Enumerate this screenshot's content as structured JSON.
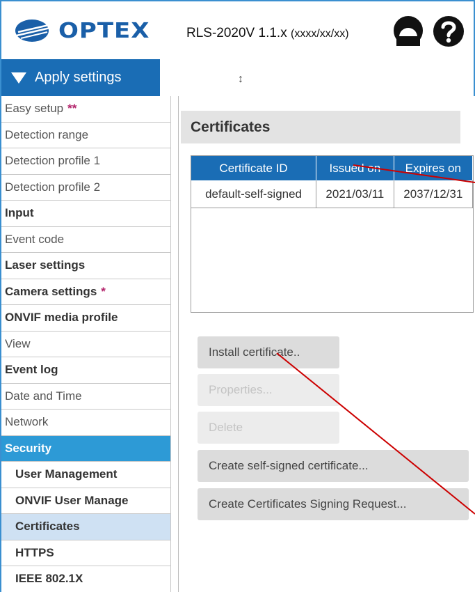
{
  "header": {
    "logo_text": "OPTEX",
    "model": "RLS-2020V 1.1.x",
    "model_date": "(xxxx/xx/xx)",
    "user_icon": "user-circle-icon",
    "help_icon": "question-circle-icon"
  },
  "apply": {
    "label": "Apply settings",
    "resize_glyph": "↕"
  },
  "sidebar": {
    "items": [
      {
        "label": "Easy setup",
        "marker": "**"
      },
      {
        "label": "Detection range",
        "marker": ""
      },
      {
        "label": "Detection profile 1",
        "marker": ""
      },
      {
        "label": "Detection profile 2",
        "marker": ""
      },
      {
        "label": "Input",
        "marker": ""
      },
      {
        "label": "Event code",
        "marker": ""
      },
      {
        "label": "Laser settings",
        "marker": ""
      },
      {
        "label": "Camera settings",
        "marker": "*"
      },
      {
        "label": "ONVIF media profile",
        "marker": ""
      },
      {
        "label": "View",
        "marker": ""
      },
      {
        "label": "Event log",
        "marker": ""
      },
      {
        "label": "Date and Time",
        "marker": ""
      },
      {
        "label": "Network",
        "marker": ""
      },
      {
        "label": "Security",
        "marker": ""
      },
      {
        "label": "User Management",
        "marker": ""
      },
      {
        "label": "ONVIF User Manage",
        "marker": ""
      },
      {
        "label": "Certificates",
        "marker": ""
      },
      {
        "label": "HTTPS",
        "marker": ""
      },
      {
        "label": "IEEE 802.1X",
        "marker": ""
      }
    ]
  },
  "main": {
    "title": "Certificates",
    "table": {
      "headers": [
        "Certificate ID",
        "Issued on",
        "Expires on"
      ],
      "rows": [
        [
          "default-self-signed",
          "2021/03/11",
          "2037/12/31"
        ]
      ]
    },
    "buttons": {
      "install": "Install certificate..",
      "properties": "Properties...",
      "delete": "Delete",
      "self_signed": "Create self-signed certificate...",
      "csr": "Create Certificates Signing Request..."
    }
  },
  "colors": {
    "brand": "#1a6db5",
    "active_nav": "#2d9ad6",
    "current_nav": "#cfe1f3",
    "marker": "#b3246b",
    "annotation_arrow": "#cc0000"
  }
}
